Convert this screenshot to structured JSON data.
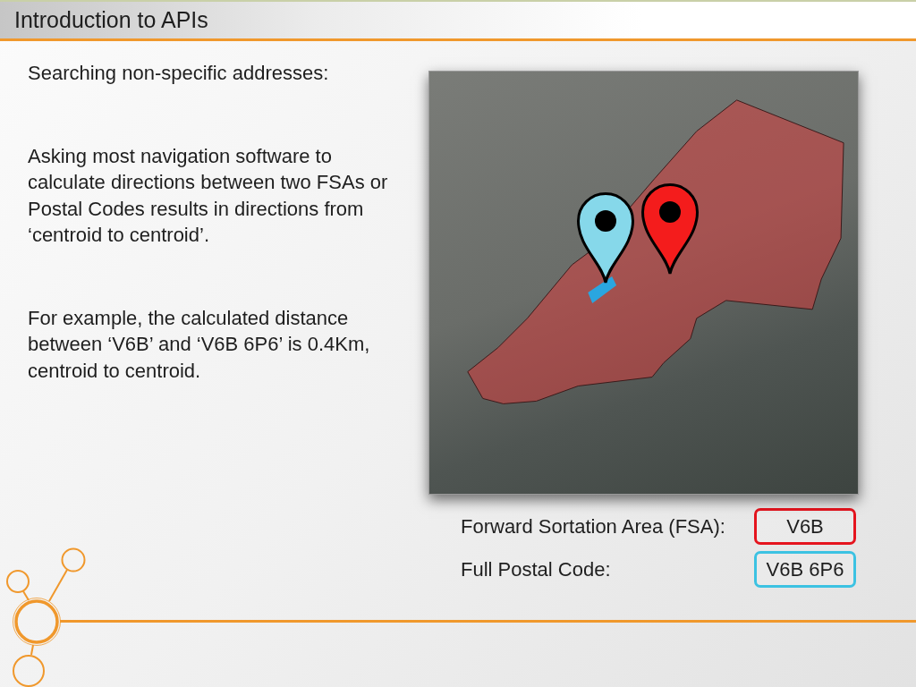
{
  "slide": {
    "title": "Introduction to APIs"
  },
  "body": {
    "heading": "Searching non-specific addresses:",
    "paragraphs": [
      "Asking most navigation software to calculate directions between two FSAs or Postal Codes results in directions from ‘centroid to centroid’.",
      "For example, the calculated distance between ‘V6B’ and ‘V6B 6P6’ is 0.4Km, centroid to centroid."
    ]
  },
  "map": {
    "pins": [
      {
        "color": "#86d8ea"
      },
      {
        "color": "#f41c1c"
      }
    ]
  },
  "codes": [
    {
      "label": "Forward Sortation Area (FSA):",
      "value": "V6B",
      "color": "#e5141e"
    },
    {
      "label": "Full Postal Code:",
      "value": "V6B 6P6",
      "color": "#3cc2e2"
    }
  ]
}
